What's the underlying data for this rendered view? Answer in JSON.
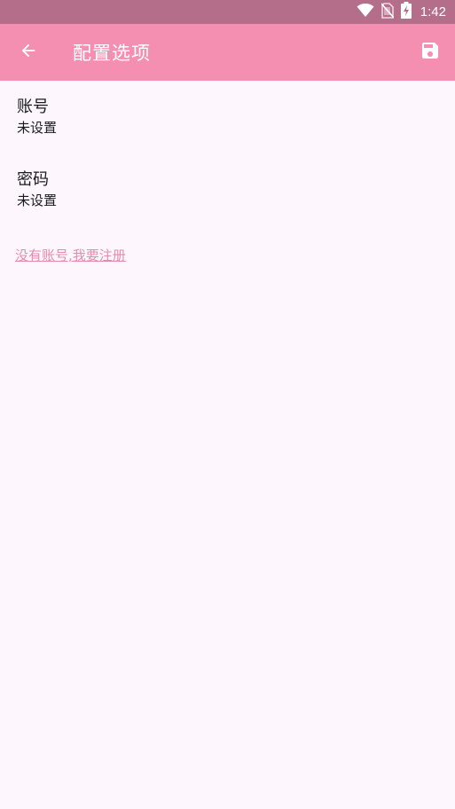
{
  "status_bar": {
    "time": "1:42",
    "icons": [
      "wifi-icon",
      "no-sim-icon",
      "battery-charging-icon"
    ]
  },
  "toolbar": {
    "title": "配置选项",
    "back_icon": "arrow-back-icon",
    "save_icon": "save-icon"
  },
  "preferences": {
    "account": {
      "title": "账号",
      "summary": "未设置"
    },
    "password": {
      "title": "密码",
      "summary": "未设置"
    }
  },
  "register_link": "没有账号,我要注册",
  "colors": {
    "status_bar": "#B56E8A",
    "toolbar": "#F48FB1",
    "background": "#FDF7FD",
    "link": "#E88AAE"
  }
}
